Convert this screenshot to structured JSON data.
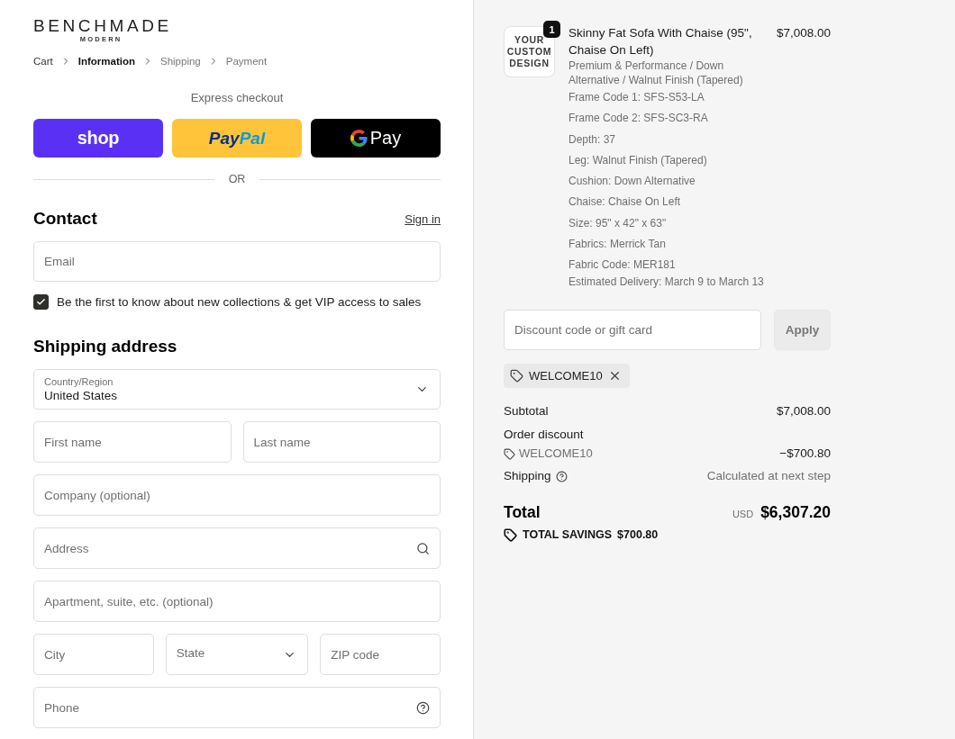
{
  "logo": {
    "name": "BENCHMADE",
    "tagline": "MODERN"
  },
  "breadcrumb": [
    {
      "label": "Cart",
      "selected": false,
      "completed": true
    },
    {
      "label": "Information",
      "selected": true,
      "completed": false
    },
    {
      "label": "Shipping",
      "selected": false,
      "completed": false
    },
    {
      "label": "Payment",
      "selected": false,
      "completed": false
    }
  ],
  "express_checkout": {
    "title": "Express checkout",
    "buttons": [
      {
        "kind": "shop",
        "label_parts": [
          "shop"
        ]
      },
      {
        "kind": "paypal",
        "label_parts": [
          "Pay",
          "Pal"
        ]
      },
      {
        "kind": "gpay",
        "label_parts": [
          "Pay"
        ]
      }
    ],
    "divider": "OR"
  },
  "contact": {
    "title": "Contact",
    "sign_in": "Sign in",
    "email": {
      "placeholder": "Email"
    },
    "newsletter": {
      "label": "Be the first to know about new collections & get VIP access to sales",
      "checked": true
    }
  },
  "shipping_address": {
    "title": "Shipping address",
    "rows": [
      [
        {
          "kind": "select",
          "label": "Country/Region",
          "value": "United States"
        }
      ],
      [
        {
          "kind": "text",
          "placeholder": "First name"
        },
        {
          "kind": "text",
          "placeholder": "Last name"
        }
      ],
      [
        {
          "kind": "text",
          "placeholder": "Company (optional)"
        }
      ],
      [
        {
          "kind": "search",
          "placeholder": "Address"
        }
      ],
      [
        {
          "kind": "text",
          "placeholder": "Apartment, suite, etc. (optional)"
        }
      ],
      [
        {
          "kind": "text",
          "placeholder": "City"
        },
        {
          "kind": "select",
          "placeholder": "State"
        },
        {
          "kind": "text",
          "placeholder": "ZIP code"
        }
      ],
      [
        {
          "kind": "help",
          "placeholder": "Phone"
        }
      ]
    ]
  },
  "order_summary": {
    "items": [
      {
        "thumbnail_text": "YOUR CUSTOM DESIGN",
        "quantity": "1",
        "title": "Skinny Fat Sofa With Chaise (95\", Chaise On Left)",
        "price": "$7,008.00",
        "variant": "Premium & Performance / Down Alternative / Walnut Finish (Tapered)",
        "properties": [
          "Frame Code 1: SFS-S53-LA",
          "Frame Code 2: SFS-SC3-RA",
          "Depth: 37",
          "Leg: Walnut Finish (Tapered)",
          "Cushion: Down Alternative",
          "Chaise: Chaise On Left",
          "Size: 95\" x 42\" x 63\"",
          "Fabrics: Merrick Tan",
          "Fabric Code: MER181"
        ],
        "estimated_delivery": "Estimated Delivery: March 9 to March 13"
      }
    ],
    "discount": {
      "placeholder": "Discount code or gift card",
      "apply": "Apply",
      "apply_disabled": true
    },
    "applied_codes": [
      {
        "code": "WELCOME10"
      }
    ],
    "lines": [
      {
        "kind": "subtotal",
        "label": "Subtotal",
        "value": "$7,008.00"
      },
      {
        "kind": "discount",
        "label": "Order discount",
        "code": "WELCOME10",
        "value": "−$700.80"
      },
      {
        "kind": "shipping",
        "label": "Shipping",
        "value": "Calculated at next step"
      }
    ],
    "total": {
      "label": "Total",
      "currency": "USD",
      "value": "$6,307.20"
    },
    "savings": {
      "label": "TOTAL SAVINGS",
      "value": "$700.80"
    }
  }
}
